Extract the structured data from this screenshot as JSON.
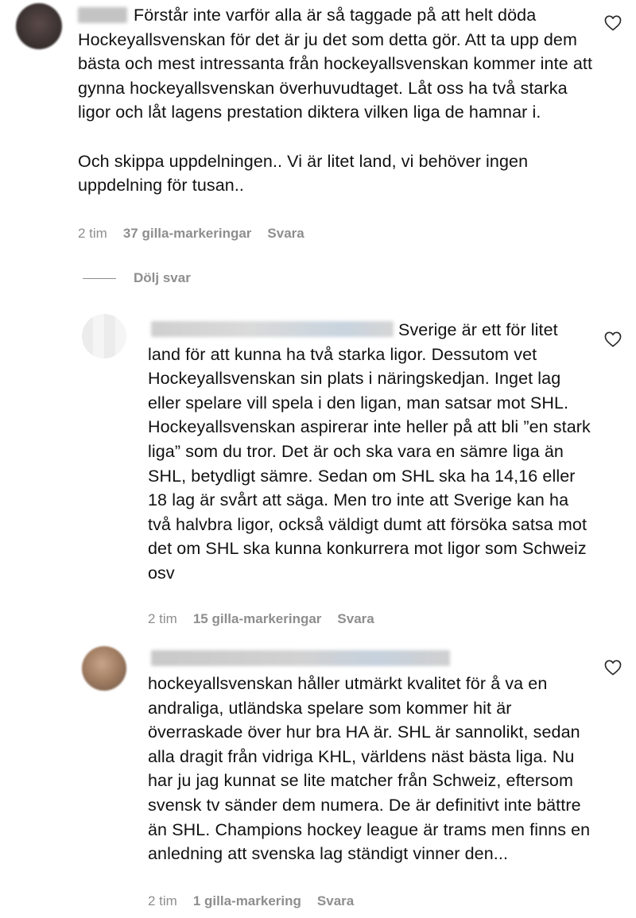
{
  "comments": [
    {
      "text": "Förstår inte varför alla är så taggade på att helt döda Hockeyallsvenskan för det är ju det som detta gör. Att ta upp dem bästa och mest intressanta från hockeyallsvenskan kommer inte att gynna hockeyallsvenskan överhuvudtaget. Låt oss ha två starka ligor och låt lagens prestation diktera vilken liga de hamnar i.\n\nOch skippa uppdelningen.. Vi är litet land, vi behöver ingen uppdelning för tusan..",
      "time": "2 tim",
      "likes": "37 gilla-markeringar",
      "reply": "Svara"
    },
    {
      "text": "Sverige är ett för litet land för att kunna ha två starka ligor. Dessutom vet Hockeyallsvenskan sin plats i näringskedjan. Inget lag eller spelare vill spela i den ligan, man satsar mot SHL. Hockeyallsvenskan aspirerar inte heller på att bli ”en stark liga” som du tror. Det är och ska vara en sämre liga än SHL, betydligt sämre. Sedan om SHL ska ha 14,16 eller 18 lag är svårt att säga. Men tro inte att Sverige kan ha två halvbra ligor, också väldigt dumt att försöka satsa mot det om SHL ska kunna konkurrera mot ligor som Schweiz osv",
      "time": "2 tim",
      "likes": "15 gilla-markeringar",
      "reply": "Svara"
    },
    {
      "text": "hockeyallsvenskan håller utmärkt kvalitet för å va en andraliga, utländska spelare som kommer hit är överraskade över hur bra HA är. SHL är sannolikt, sedan alla dragit från vidriga KHL, världens näst bästa liga. Nu har ju jag kunnat se lite matcher från Schweiz, eftersom svensk tv sänder dem numera. De är definitivt inte bättre än SHL. Champions hockey league är trams men finns en anledning att svenska lag ständigt vinner den...",
      "time": "2 tim",
      "likes": "1 gilla-markering",
      "reply": "Svara"
    }
  ],
  "hide_replies_label": "Dölj svar",
  "colors": {
    "text": "#111111",
    "meta": "#8e8e8e",
    "background": "#ffffff"
  },
  "icons": {
    "like": "heart-outline-icon"
  }
}
